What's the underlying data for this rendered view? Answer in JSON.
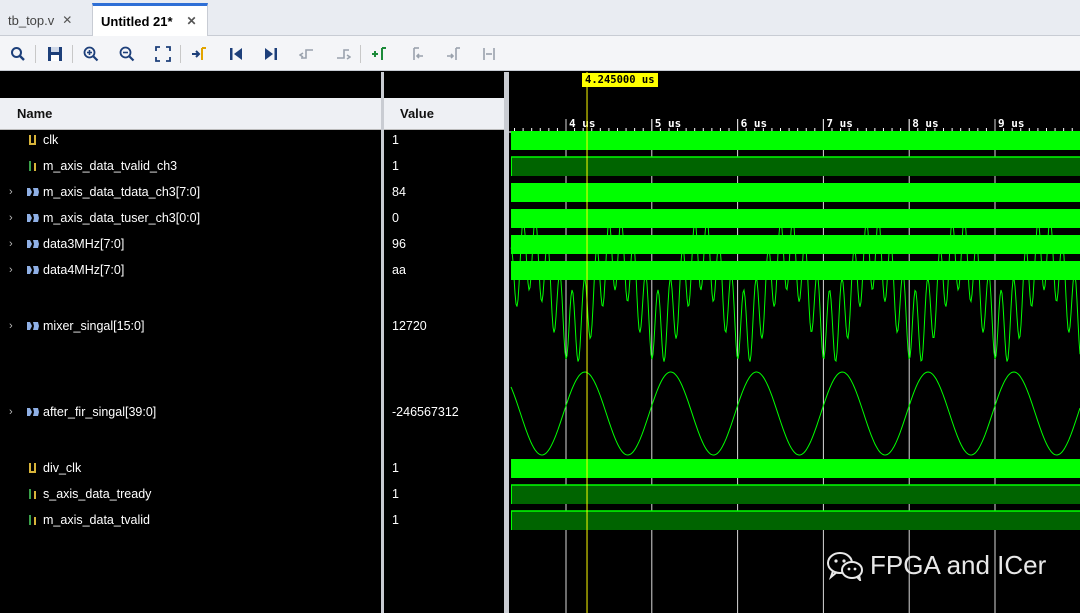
{
  "tabs": [
    {
      "label": "tb_top.v",
      "active": false
    },
    {
      "label": "Untitled 21*",
      "active": true
    }
  ],
  "toolbar_icons": [
    "search-icon",
    "save-icon",
    "zoom-in-icon",
    "zoom-out-icon",
    "zoom-fit-icon",
    "go-to-cursor-icon",
    "go-to-time-zero-icon",
    "go-to-last-time-icon",
    "previous-transition-icon",
    "next-transition-icon",
    "add-marker-icon",
    "previous-marker-icon",
    "next-marker-icon",
    "swap-cursors-icon"
  ],
  "columns": {
    "name": "Name",
    "value": "Value"
  },
  "cursor": {
    "time_label": "4.245000  us",
    "time_us": 4.245
  },
  "time_axis": {
    "ticks": [
      "4 us",
      "5 us",
      "6 us",
      "7 us",
      "8 us",
      "9 us"
    ]
  },
  "signals": [
    {
      "name": "clk",
      "value": "1",
      "expandable": false,
      "kind": "bit-clock",
      "display": "bus"
    },
    {
      "name": "m_axis_data_tvalid_ch3",
      "value": "1",
      "expandable": false,
      "kind": "bit",
      "display": "high"
    },
    {
      "name": "m_axis_data_tdata_ch3[7:0]",
      "value": "84",
      "expandable": true,
      "kind": "bus",
      "display": "bus"
    },
    {
      "name": "m_axis_data_tuser_ch3[0:0]",
      "value": "0",
      "expandable": true,
      "kind": "bus",
      "display": "bus"
    },
    {
      "name": "data3MHz[7:0]",
      "value": "96",
      "expandable": true,
      "kind": "bus",
      "display": "bus"
    },
    {
      "name": "data4MHz[7:0]",
      "value": "aa",
      "expandable": true,
      "kind": "bus",
      "display": "bus"
    },
    {
      "name": "mixer_singal[15:0]",
      "value": "12720",
      "expandable": true,
      "kind": "bus",
      "display": "analog-mix"
    },
    {
      "name": "after_fir_singal[39:0]",
      "value": "-246567312",
      "expandable": true,
      "kind": "bus",
      "display": "analog-sine"
    },
    {
      "name": "div_clk",
      "value": "1",
      "expandable": false,
      "kind": "bit-clock",
      "display": "bus"
    },
    {
      "name": "s_axis_data_tready",
      "value": "1",
      "expandable": false,
      "kind": "bit",
      "display": "high"
    },
    {
      "name": "m_axis_data_tvalid",
      "value": "1",
      "expandable": false,
      "kind": "bit",
      "display": "high"
    }
  ],
  "watermark": {
    "text": "FPGA and ICer",
    "icon": "wechat-icon"
  },
  "colors": {
    "waveform": "#00ff00",
    "bit_high_fill": "#006400",
    "cursor": "#ffff00",
    "grid": "#ffffff"
  }
}
